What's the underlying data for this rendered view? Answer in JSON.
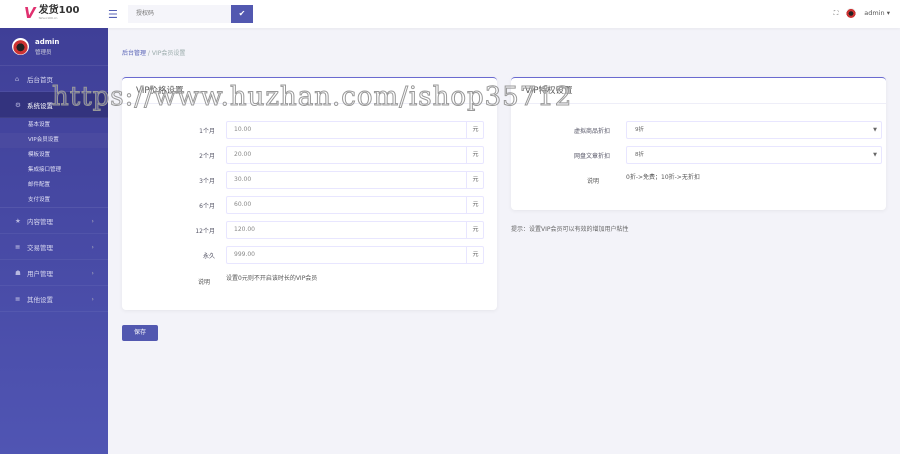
{
  "header": {
    "logo_mark": "V",
    "logo_name": "发货100",
    "logo_sub": "fahuo100.cn",
    "search_placeholder": "授权码",
    "search_btn": "✔",
    "user": "admin ▾",
    "fullscreen": "⛶"
  },
  "sidebar": {
    "username": "admin",
    "role": "管理员",
    "items": [
      {
        "label": "后台首页",
        "icon": "⌂"
      },
      {
        "label": "系统设置",
        "icon": "⚙"
      }
    ],
    "sub_items": [
      "基本设置",
      "VIP会员设置",
      "模板设置",
      "集成接口管理",
      "邮件配置",
      "支付设置"
    ],
    "groups": [
      {
        "label": "内容管理",
        "icon": "★"
      },
      {
        "label": "交易管理",
        "icon": "≣"
      },
      {
        "label": "用户管理",
        "icon": "☗"
      },
      {
        "label": "其他设置",
        "icon": "≣"
      }
    ]
  },
  "breadcrumb": {
    "root": "后台管理",
    "sep": " / ",
    "current": "VIP会员设置"
  },
  "price_card": {
    "title": "VIP价格设置",
    "unit": "元",
    "rows": [
      {
        "label": "1个月",
        "value": "10.00"
      },
      {
        "label": "2个月",
        "value": "20.00"
      },
      {
        "label": "3个月",
        "value": "30.00"
      },
      {
        "label": "6个月",
        "value": "60.00"
      },
      {
        "label": "12个月",
        "value": "120.00"
      },
      {
        "label": "永久",
        "value": "999.00"
      }
    ],
    "note_label": "说明",
    "note": "设置0元则不开启该时长的VIP会员"
  },
  "priv_card": {
    "title": "VIP特权设置",
    "rows": [
      {
        "label": "虚拟商品折扣",
        "value": "9折"
      },
      {
        "label": "网盘文章折扣",
        "value": "8折"
      }
    ],
    "note_label": "说明",
    "note": "0折->免费；10折->无折扣"
  },
  "tip": "提示：设置VIP会员可以有效的增加用户粘性",
  "save": "保存",
  "watermark": "https://www.huzhan.com/ishop35712"
}
